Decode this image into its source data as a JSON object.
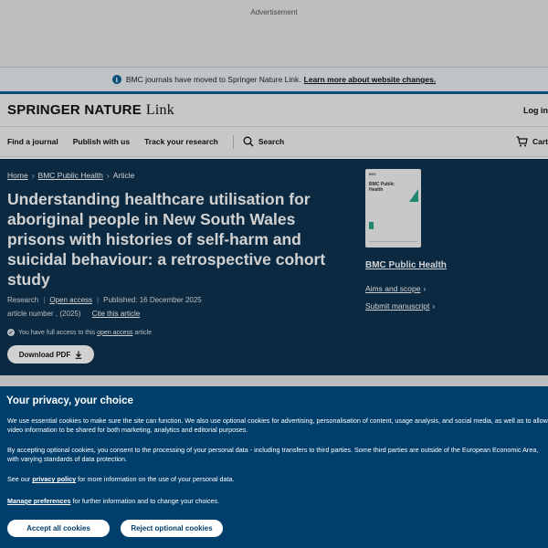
{
  "ad": {
    "label": "Advertisement"
  },
  "notice": {
    "text": "BMC journals have moved to Springer Nature Link.",
    "link": "Learn more about website changes."
  },
  "brand": {
    "logo_main": "SPRINGER NATURE",
    "logo_link": "Link",
    "login": "Log in"
  },
  "nav": {
    "items": [
      "Find a journal",
      "Publish with us",
      "Track your research"
    ],
    "search": "Search",
    "cart": "Cart"
  },
  "breadcrumb": {
    "items": [
      "Home",
      "BMC Public Health",
      "Article"
    ]
  },
  "article": {
    "title": "Understanding healthcare utilisation for aboriginal people in New South Wales prisons with histories of self-harm and suicidal behaviour: a retrospective cohort study",
    "type": "Research",
    "open_access": "Open access",
    "published": "Published: 16 December 2025",
    "article_number": "article number , (2025)",
    "cite": "Cite this article",
    "access_prefix": "You have full access to this",
    "access_link": "open access",
    "access_suffix": "article",
    "download": "Download PDF"
  },
  "journal": {
    "cover_brand": "BMC",
    "cover_title": "BMC Public Health",
    "name": "BMC Public Health",
    "aims": "Aims and scope",
    "submit": "Submit manuscript"
  },
  "cookie": {
    "heading": "Your privacy, your choice",
    "p1": "We use essential cookies to make sure the site can function. We also use optional cookies for advertising, personalisation of content, usage analysis, and social media, as well as to allow video information to be shared for both marketing, analytics and editorial purposes.",
    "p2": "By accepting optional cookies, you consent to the processing of your personal data - including transfers to third parties. Some third parties are outside of the European Economic Area, with varying standards of data protection.",
    "p3_prefix": "See our",
    "p3_link": "privacy policy",
    "p3_suffix": "for more information on the use of your personal data.",
    "p4_link": "Manage preferences",
    "p4_suffix": "for further information and to change your choices.",
    "accept": "Accept all cookies",
    "reject": "Reject optional cookies"
  }
}
